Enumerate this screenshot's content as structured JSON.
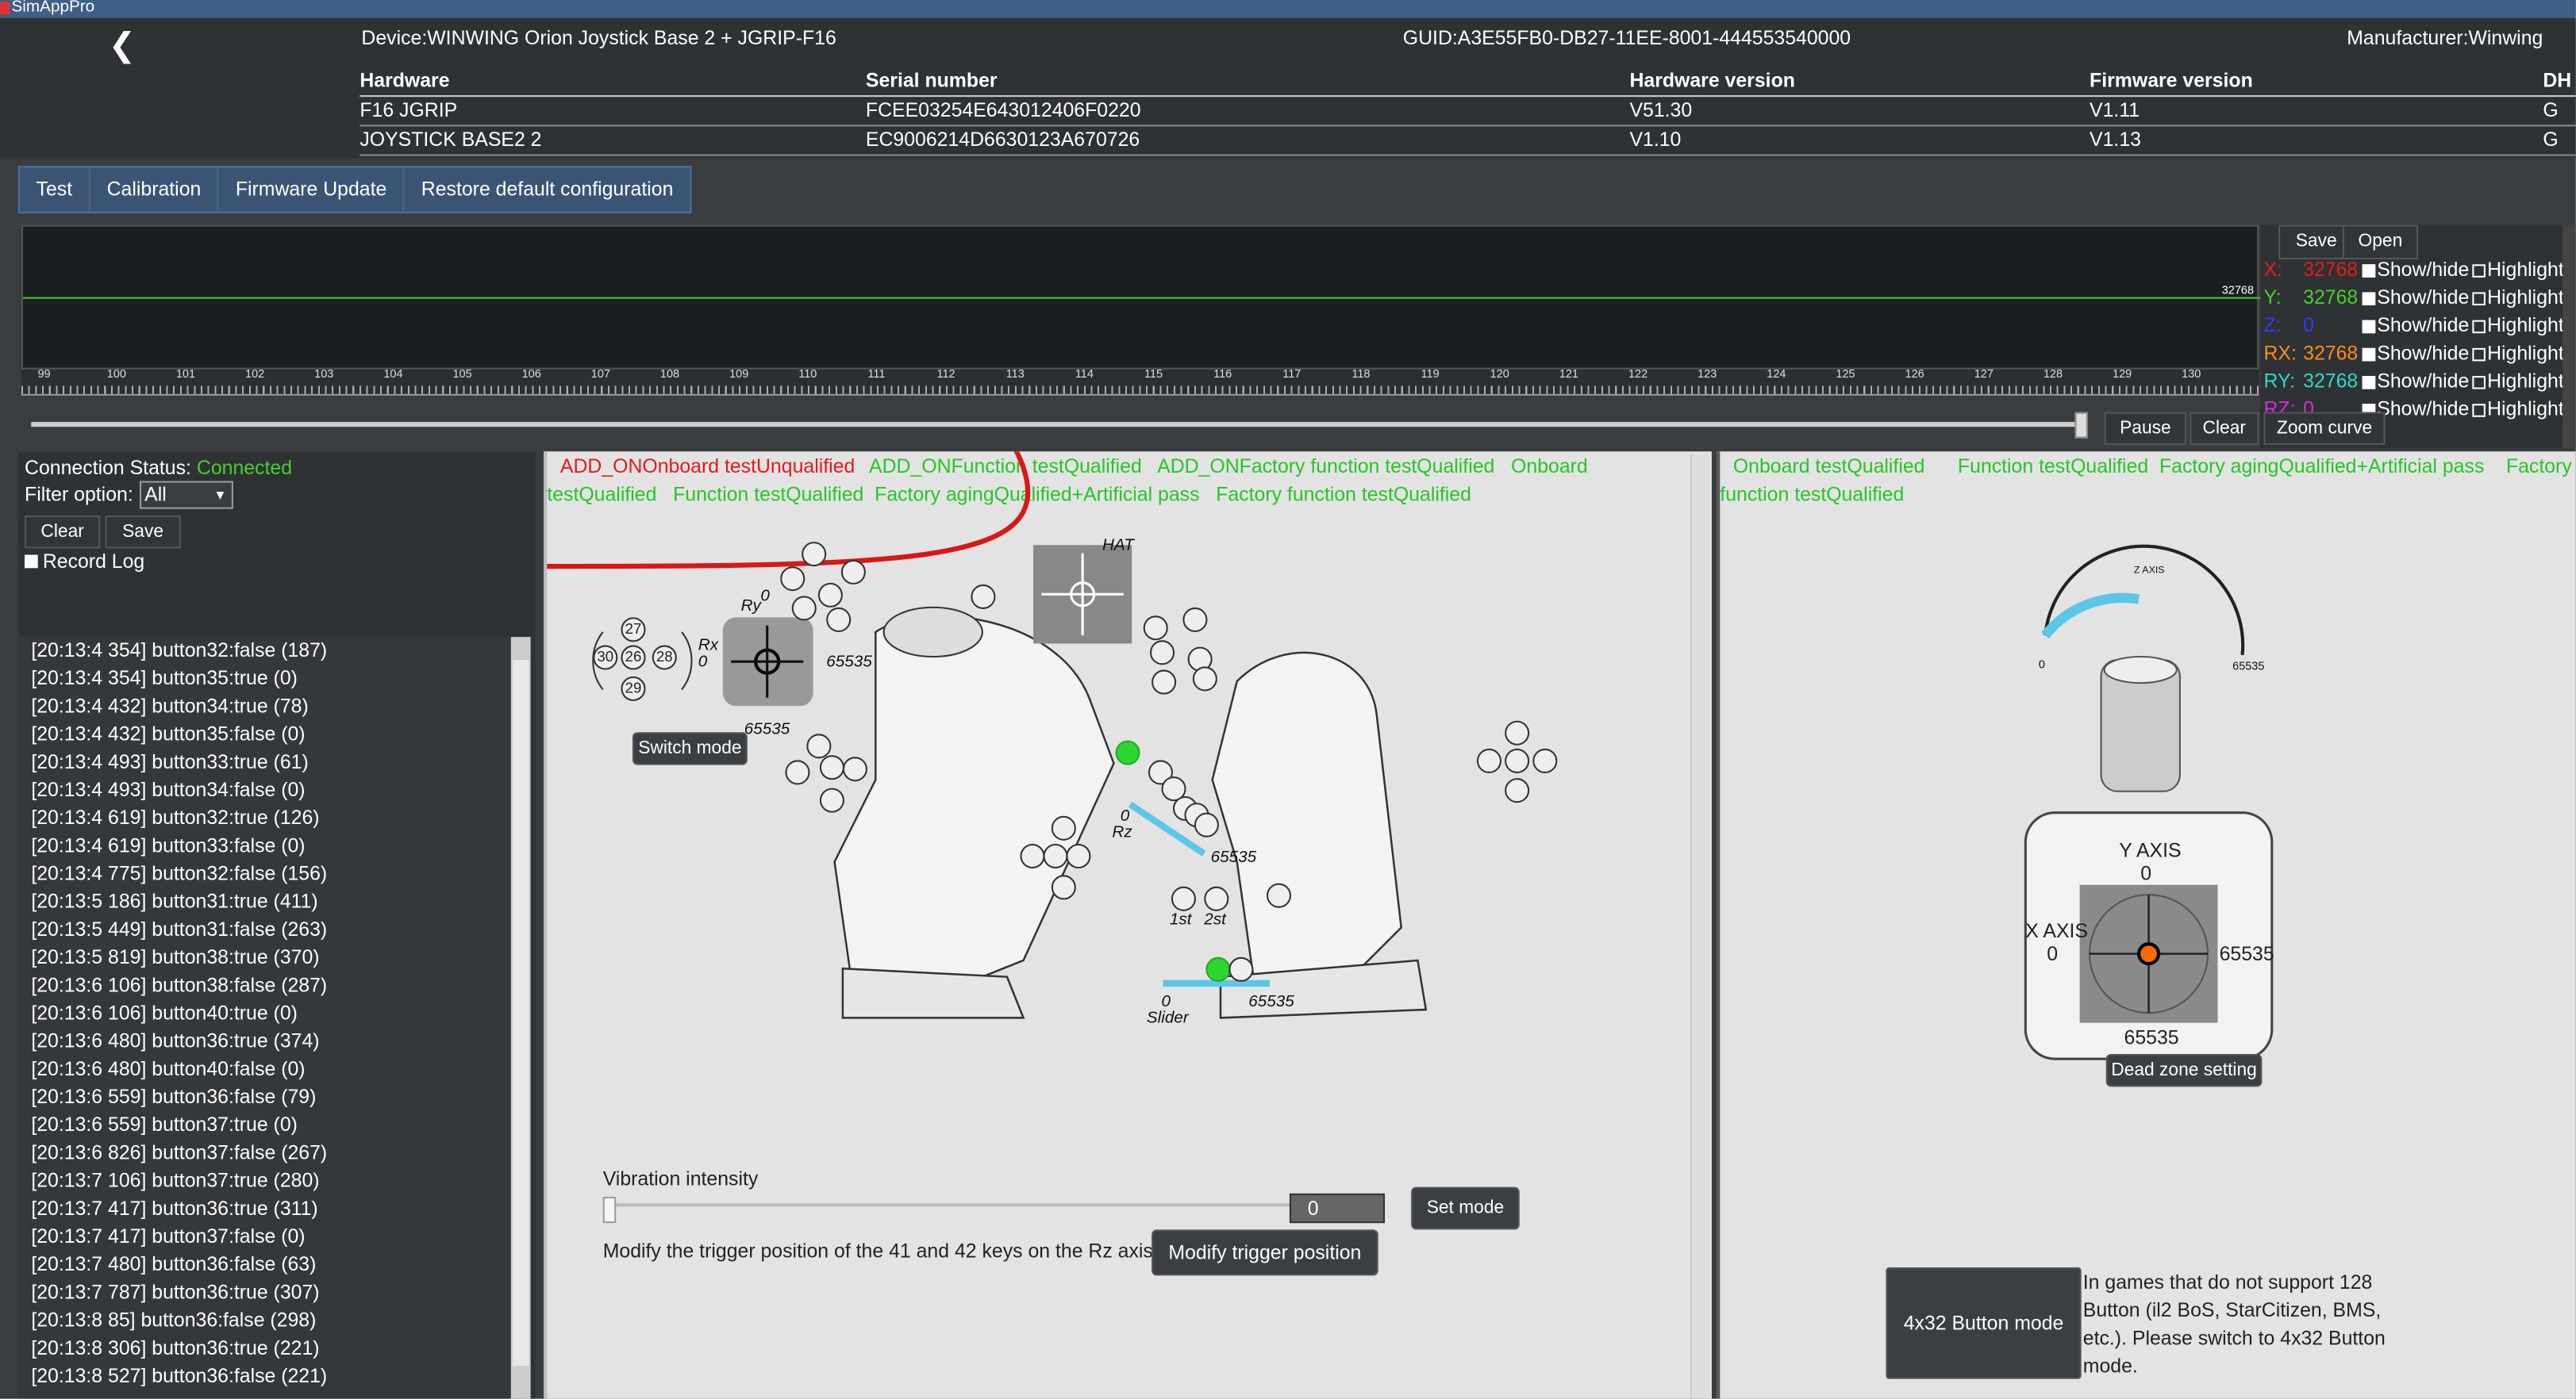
{
  "app": {
    "title": "SimAppPro"
  },
  "header": {
    "device": "Device:WINWING Orion Joystick Base 2 + JGRIP-F16",
    "guid": "GUID:A3E55FB0-DB27-11EE-8001-444553540000",
    "manufacturer": "Manufacturer:Winwing",
    "columns": [
      "Hardware",
      "Serial number",
      "Hardware version",
      "Firmware version",
      "DH"
    ],
    "rows": [
      [
        "F16 JGRIP",
        "FCEE03254E643012406F0220",
        "V51.30",
        "V1.11",
        "G"
      ],
      [
        "JOYSTICK BASE2 2",
        "EC9006214D6630123A670726",
        "V1.10",
        "V1.13",
        "G"
      ]
    ]
  },
  "tabs": [
    "Test",
    "Calibration",
    "Firmware Update",
    "Restore default configuration"
  ],
  "graph": {
    "current_value": "32768",
    "ticks": [
      "99",
      "100",
      "101",
      "102",
      "103",
      "104",
      "105",
      "106",
      "107",
      "108",
      "109",
      "110",
      "111",
      "112",
      "113",
      "114",
      "115",
      "116",
      "117",
      "118",
      "119",
      "120",
      "121",
      "122",
      "123",
      "124",
      "125",
      "126",
      "127",
      "128",
      "129",
      "130"
    ],
    "line_color": "#4cbf28"
  },
  "axes_panel": {
    "save": "Save",
    "open": "Open",
    "show_hide": "Show/hide",
    "highlight": "Highlight",
    "axes": [
      {
        "name": "X:",
        "value": "32768",
        "color": "#e31b1b"
      },
      {
        "name": "Y:",
        "value": "32768",
        "color": "#45d12b"
      },
      {
        "name": "Z:",
        "value": "0",
        "color": "#2a3cff"
      },
      {
        "name": "RX:",
        "value": "32768",
        "color": "#ff8c1a"
      },
      {
        "name": "RY:",
        "value": "32768",
        "color": "#33d6c8"
      },
      {
        "name": "RZ:",
        "value": "0",
        "color": "#d62bd6"
      }
    ]
  },
  "playback": {
    "pause": "Pause",
    "clear": "Clear",
    "zoom": "Zoom curve"
  },
  "left": {
    "conn_label": "Connection Status:",
    "conn_value": "Connected",
    "filter_label": "Filter option:",
    "filter_value": "All",
    "clear": "Clear",
    "save": "Save",
    "record_log": "Record Log",
    "log": [
      "[20:13:4 354] button32:false (187)",
      "[20:13:4 354] button35:true (0)",
      "[20:13:4 432] button34:true (78)",
      "[20:13:4 432] button35:false (0)",
      "[20:13:4 493] button33:true (61)",
      "[20:13:4 493] button34:false (0)",
      "[20:13:4 619] button32:true (126)",
      "[20:13:4 619] button33:false (0)",
      "[20:13:4 775] button32:false (156)",
      "[20:13:5 186] button31:true (411)",
      "[20:13:5 449] button31:false (263)",
      "[20:13:5 819] button38:true (370)",
      "[20:13:6 106] button38:false (287)",
      "[20:13:6 106] button40:true (0)",
      "[20:13:6 480] button36:true (374)",
      "[20:13:6 480] button40:false (0)",
      "[20:13:6 559] button36:false (79)",
      "[20:13:6 559] button37:true (0)",
      "[20:13:6 826] button37:false (267)",
      "[20:13:7 106] button37:true (280)",
      "[20:13:7 417] button36:true (311)",
      "[20:13:7 417] button37:false (0)",
      "[20:13:7 480] button36:false (63)",
      "[20:13:7 787] button36:true (307)",
      "[20:13:8 85] button36:false (298)",
      "[20:13:8 306] button36:true (221)",
      "[20:13:8 527] button36:false (221)"
    ]
  },
  "center": {
    "status_red": "ADD_ONOnboard testUnqualified",
    "status_line1": "ADD_ONFunction testQualified   ADD_ONFactory function testQualified   Onboard",
    "status_line2": "testQualified   Function testQualified  Factory agingQualified+Artificial pass   Factory function testQualified",
    "switch_mode": "Switch mode",
    "hat": "HAT",
    "rx_label": "Rx",
    "rx_min": "0",
    "rx_max": "65535",
    "ry_label": "Ry",
    "ry_min": "0",
    "ry_max": "65535",
    "rz_label": "Rz",
    "rz_min": "0",
    "rz_max": "65535",
    "slider_label": "Slider",
    "slider_min": "0",
    "slider_max": "65535",
    "first": "1st",
    "second": "2st",
    "btn_nums": [
      "27",
      "30",
      "26",
      "28",
      "29"
    ],
    "vibration": "Vibration intensity",
    "vibration_value": "0",
    "set_mode": "Set mode",
    "modify_text": "Modify the trigger position of the 41 and 42 keys on the Rz axis",
    "modify_btn": "Modify trigger position"
  },
  "right": {
    "status_line1": "Onboard testQualified      Function testQualified  Factory agingQualified+Artificial pass    Factory",
    "status_line2": "function testQualified",
    "z_axis": "Z AXIS",
    "z_min": "0",
    "z_max": "65535",
    "y_axis": "Y AXIS",
    "y_min": "0",
    "y_max": "65535",
    "x_axis": "X AXIS",
    "x_min": "0",
    "x_max": "65535",
    "dead_zone": "Dead zone setting",
    "mode_btn": "4x32 Button mode",
    "mode_text": "In games that do not support 128 Button (il2 BoS, StarCitizen, BMS, etc.). Please switch to 4x32 Button mode."
  }
}
